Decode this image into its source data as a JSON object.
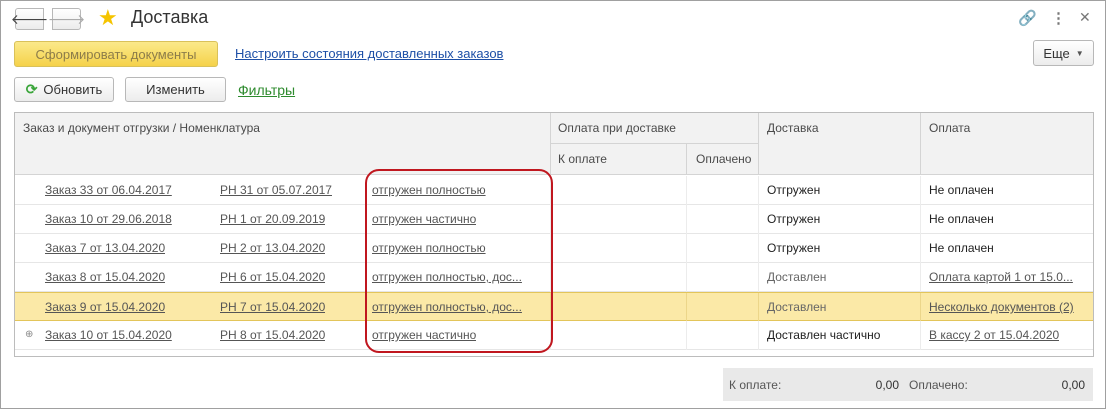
{
  "window": {
    "title": "Доставка",
    "icons": {
      "back": "arrow-left-icon",
      "forward": "arrow-right-icon",
      "favorite": "star-icon",
      "link": "link-icon",
      "menu": "more-vertical-icon",
      "close": "close-icon"
    }
  },
  "commands": {
    "generate_docs": "Сформировать документы",
    "configure_link": "Настроить состояния доставленных заказов",
    "more": "Еще",
    "refresh": "Обновить",
    "edit": "Изменить",
    "filters": "Фильтры"
  },
  "table": {
    "headers": {
      "order": "Заказ и документ отгрузки / Номенклатура",
      "payment_on_delivery": "Оплата при доставке",
      "to_pay": "К оплате",
      "paid": "Оплачено",
      "delivery": "Доставка",
      "payment": "Оплата"
    },
    "rows": [
      {
        "order": "Заказ 33 от 06.04.2017",
        "shipment_doc": "РН 31 от 05.07.2017",
        "shipment_state": "отгружен полностью",
        "delivery": "Отгружен",
        "payment": "Не оплачен",
        "payment_is_link": false,
        "selected": false,
        "expandable": false
      },
      {
        "order": "Заказ 10 от 29.06.2018",
        "shipment_doc": "РН 1 от 20.09.2019",
        "shipment_state": "отгружен частично",
        "delivery": "Отгружен",
        "payment": "Не оплачен",
        "payment_is_link": false,
        "selected": false,
        "expandable": false
      },
      {
        "order": "Заказ 7 от 13.04.2020",
        "shipment_doc": "РН 2 от 13.04.2020",
        "shipment_state": "отгружен полностью",
        "delivery": "Отгружен",
        "payment": "Не оплачен",
        "payment_is_link": false,
        "selected": false,
        "expandable": false
      },
      {
        "order": "Заказ 8 от 15.04.2020",
        "shipment_doc": "РН 6 от 15.04.2020",
        "shipment_state": "отгружен полностью, дос...",
        "delivery": "Доставлен",
        "payment": "Оплата картой 1 от 15.0...",
        "payment_is_link": true,
        "selected": false,
        "expandable": false
      },
      {
        "order": "Заказ 9 от 15.04.2020",
        "shipment_doc": "РН 7 от 15.04.2020",
        "shipment_state": "отгружен полностью, дос...",
        "delivery": "Доставлен",
        "payment": "Несколько документов (2)",
        "payment_is_link": true,
        "selected": true,
        "expandable": false
      },
      {
        "order": "Заказ 10 от 15.04.2020",
        "shipment_doc": "РН 8 от 15.04.2020",
        "shipment_state": "отгружен частично",
        "delivery": "Доставлен частично",
        "payment": "В кассу 2 от 15.04.2020",
        "payment_is_link": true,
        "selected": false,
        "expandable": true
      }
    ]
  },
  "footer": {
    "to_pay_label": "К оплате:",
    "to_pay_value": "0,00",
    "paid_label": "Оплачено:",
    "paid_value": "0,00"
  },
  "colors": {
    "primary_button": "#f5d24a",
    "selected_row": "#fbe9a7",
    "highlight_annotation": "#c0171f",
    "filters_link": "#2e8b2e"
  }
}
